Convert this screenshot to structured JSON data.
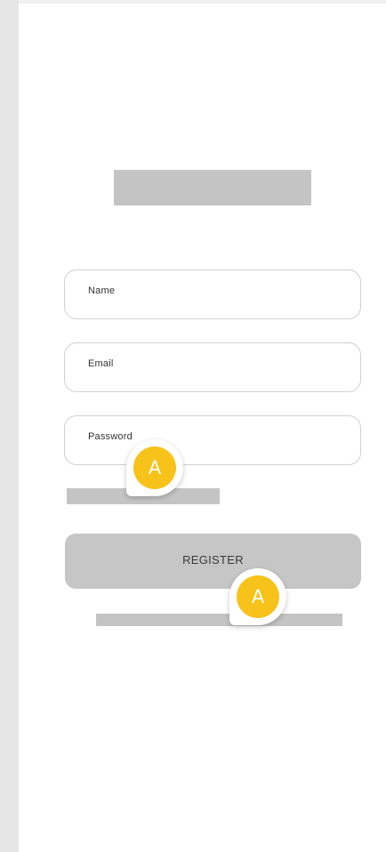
{
  "form": {
    "name_placeholder": "Name",
    "email_placeholder": "Email",
    "password_placeholder": "Password",
    "register_label": "REGISTER"
  },
  "annotations": [
    {
      "label": "A"
    },
    {
      "label": "A"
    }
  ],
  "colors": {
    "placeholder_block": "#c4c4c4",
    "button_bg": "#c6c6c6",
    "marker": "#f7c21a"
  }
}
